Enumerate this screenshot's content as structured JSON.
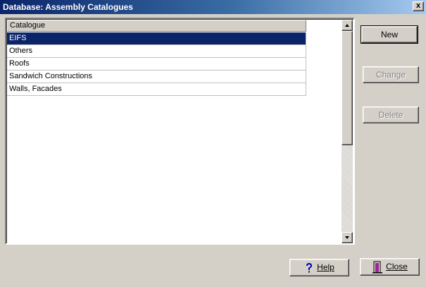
{
  "window": {
    "title": "Database: Assembly Catalogues",
    "close_glyph": "x"
  },
  "list": {
    "column_header": "Catalogue",
    "rows": [
      "EIFS",
      "Others",
      "Roofs",
      "Sandwich Constructions",
      "Walls, Facades"
    ],
    "selected_index": 0
  },
  "buttons": {
    "new_label": "New",
    "change_label": "Change",
    "delete_label": "Delete",
    "help_label": "Help",
    "close_label": "Close"
  },
  "icons": {
    "help": "question-mark-icon",
    "close": "door-exit-icon"
  },
  "colors": {
    "selection": "#0a246a",
    "help_icon": "#0000c0",
    "close_icon": "#a020a0"
  }
}
